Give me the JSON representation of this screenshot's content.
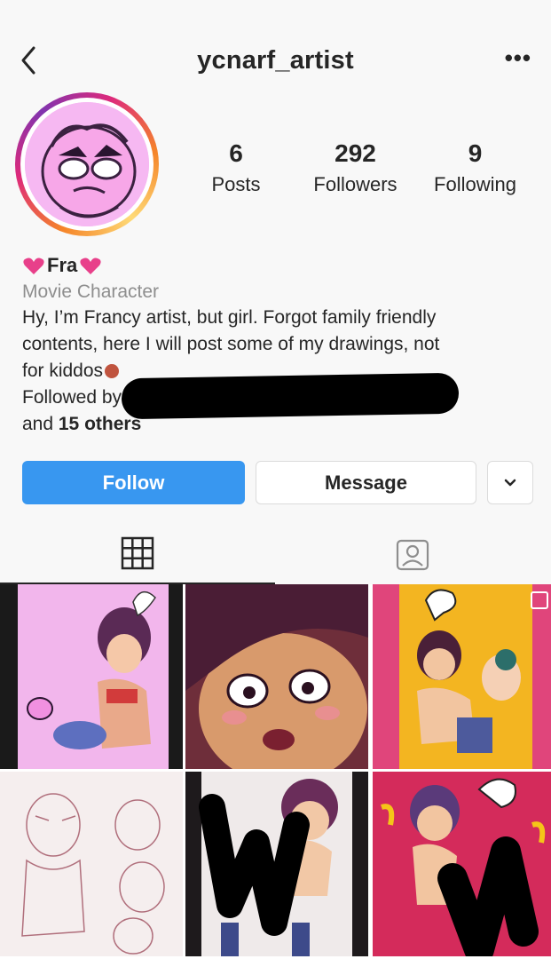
{
  "header": {
    "username": "ycnarf_artist",
    "back_icon": "chevron-left-icon",
    "more_icon": "more-horizontal-icon",
    "more_label": "•••"
  },
  "profile": {
    "stats": [
      {
        "value": "6",
        "label": "Posts"
      },
      {
        "value": "292",
        "label": "Followers"
      },
      {
        "value": "9",
        "label": "Following"
      }
    ]
  },
  "bio": {
    "name": "Fra",
    "category": "Movie Character",
    "text_lines": [
      "Hy, I’m Francy artist, but girl. Forgot family friendly",
      "contents, here I will post some of my drawings, not",
      "for kiddos"
    ],
    "followed_by_prefix": "Followed by",
    "followed_by_suffix_and": "and ",
    "followed_by_others": "15 others"
  },
  "actions": {
    "follow_label": "Follow",
    "message_label": "Message",
    "dropdown_icon": "chevron-down-icon"
  },
  "tabs": {
    "grid_icon": "grid-icon",
    "tagged_icon": "tagged-person-icon"
  },
  "colors": {
    "follow_blue": "#3897f0",
    "text": "#262626",
    "muted": "#8e8e8e",
    "heart_pink": "#e8408a"
  }
}
